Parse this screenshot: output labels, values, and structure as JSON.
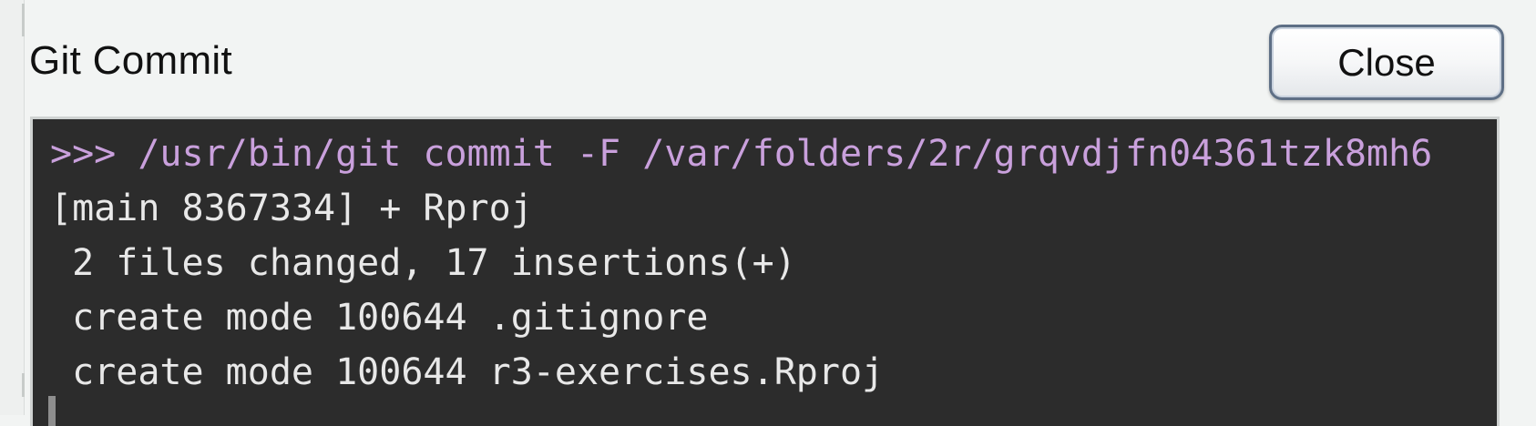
{
  "dialog": {
    "title": "Git Commit",
    "close_label": "Close"
  },
  "console": {
    "command_line": ">>> /usr/bin/git commit -F /var/folders/2r/grqvdjfn04361tzk8mh6",
    "output_lines": [
      "[main 8367334] + Rproj",
      " 2 files changed, 17 insertions(+)",
      " create mode 100644 .gitignore",
      " create mode 100644 r3-exercises.Rproj"
    ],
    "colors": {
      "background": "#2c2c2c",
      "command": "#c9a0dc",
      "output": "#e8e8e8"
    }
  }
}
